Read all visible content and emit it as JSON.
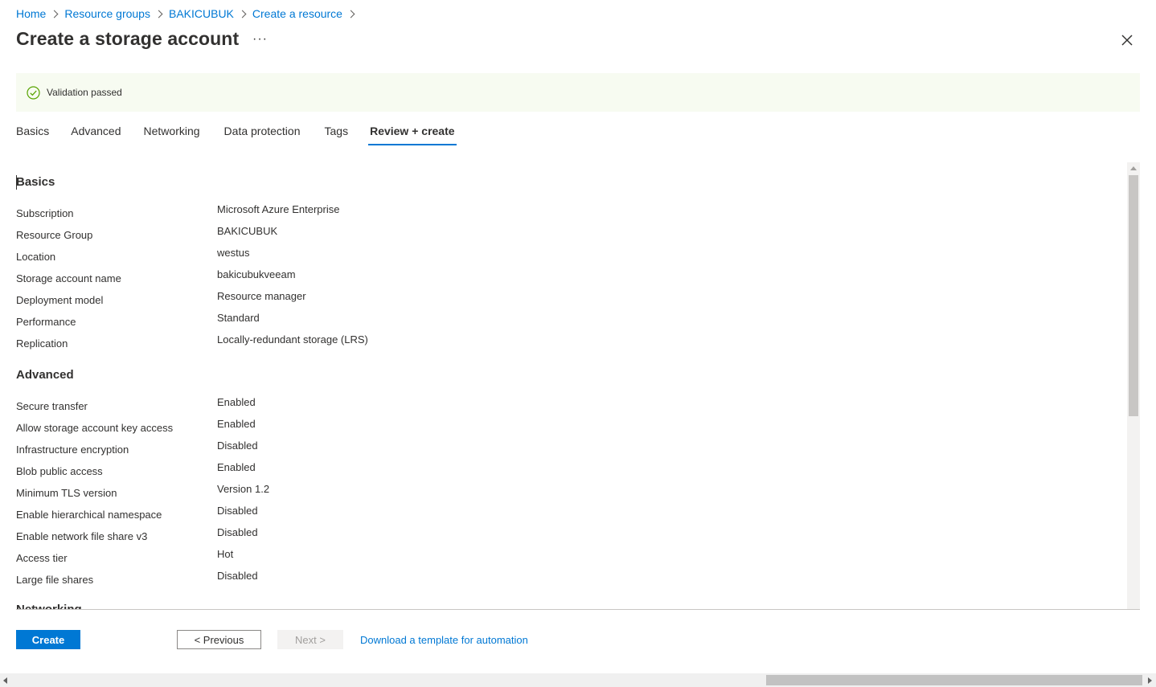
{
  "breadcrumb": [
    {
      "label": "Home"
    },
    {
      "label": "Resource groups"
    },
    {
      "label": "BAKICUBUK"
    },
    {
      "label": "Create a resource"
    }
  ],
  "page": {
    "title": "Create a storage account",
    "more_label": "···"
  },
  "validation": {
    "text": "Validation passed",
    "status_color": "#57a300",
    "background_color": "#f7fbf1"
  },
  "tabs": [
    {
      "label": "Basics",
      "active": false
    },
    {
      "label": "Advanced",
      "active": false
    },
    {
      "label": "Networking",
      "active": false
    },
    {
      "label": "Data protection",
      "active": false
    },
    {
      "label": "Tags",
      "active": false
    },
    {
      "label": "Review + create",
      "active": true
    }
  ],
  "sections": {
    "basics": {
      "heading": "Basics",
      "rows": [
        {
          "label": "Subscription",
          "value": "Microsoft Azure Enterprise"
        },
        {
          "label": "Resource Group",
          "value": "BAKICUBUK"
        },
        {
          "label": "Location",
          "value": "westus"
        },
        {
          "label": "Storage account name",
          "value": "bakicubukveeam"
        },
        {
          "label": "Deployment model",
          "value": "Resource manager"
        },
        {
          "label": "Performance",
          "value": "Standard"
        },
        {
          "label": "Replication",
          "value": "Locally-redundant storage (LRS)"
        }
      ]
    },
    "advanced": {
      "heading": "Advanced",
      "rows": [
        {
          "label": "Secure transfer",
          "value": "Enabled"
        },
        {
          "label": "Allow storage account key access",
          "value": "Enabled"
        },
        {
          "label": "Infrastructure encryption",
          "value": "Disabled"
        },
        {
          "label": "Blob public access",
          "value": "Enabled"
        },
        {
          "label": "Minimum TLS version",
          "value": "Version 1.2"
        },
        {
          "label": "Enable hierarchical namespace",
          "value": "Disabled"
        },
        {
          "label": "Enable network file share v3",
          "value": "Disabled"
        },
        {
          "label": "Access tier",
          "value": "Hot"
        },
        {
          "label": "Large file shares",
          "value": "Disabled"
        }
      ]
    },
    "networking": {
      "heading": "Networking"
    }
  },
  "footer": {
    "create_label": "Create",
    "previous_label": "< Previous",
    "next_label": "Next >",
    "download_link": "Download a template for automation"
  },
  "colors": {
    "accent": "#0078d4",
    "text": "#323130"
  }
}
